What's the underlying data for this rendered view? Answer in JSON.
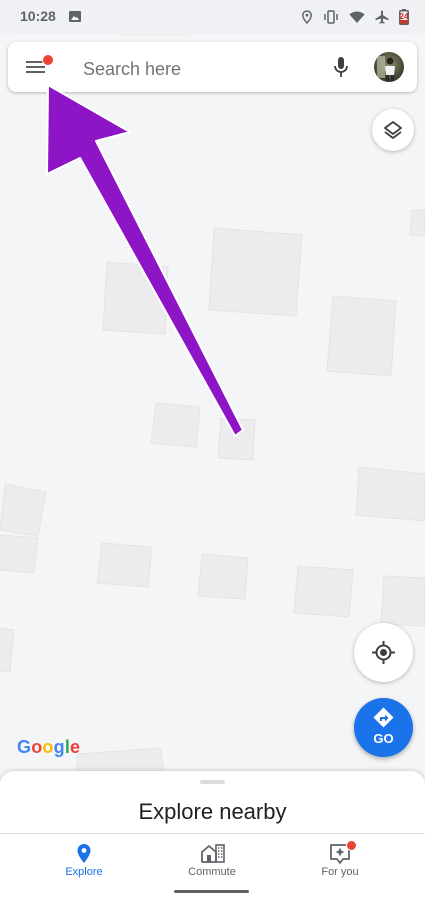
{
  "status_bar": {
    "time": "10:28",
    "battery_level": "24",
    "icons": [
      "image-icon",
      "location-icon",
      "vibrate-icon",
      "wifi-icon",
      "airplane-icon",
      "battery-icon"
    ]
  },
  "search": {
    "placeholder": "Search here",
    "menu_icon": "menu-icon",
    "voice_icon": "mic-icon",
    "account_icon": "avatar"
  },
  "fabs": {
    "layers_icon": "layers-icon",
    "location_icon": "my-location-icon",
    "go_label": "GO"
  },
  "google_logo": {
    "letters": [
      {
        "ch": "G",
        "color": "#4285F4"
      },
      {
        "ch": "o",
        "color": "#EA4335"
      },
      {
        "ch": "o",
        "color": "#FBBC05"
      },
      {
        "ch": "g",
        "color": "#4285F4"
      },
      {
        "ch": "l",
        "color": "#34A853"
      },
      {
        "ch": "e",
        "color": "#EA4335"
      }
    ]
  },
  "sheet": {
    "title": "Explore nearby"
  },
  "nav": {
    "items": [
      {
        "label": "Explore",
        "icon": "explore-pin-icon",
        "active": true
      },
      {
        "label": "Commute",
        "icon": "commute-icon",
        "active": false
      },
      {
        "label": "For you",
        "icon": "for-you-icon",
        "active": false
      }
    ]
  },
  "colors": {
    "accent": "#1a73e8",
    "notification": "#ea4335",
    "annotation_arrow": "#8e15c6",
    "map_bg": "#f4f5f7",
    "building": "#ececee"
  }
}
